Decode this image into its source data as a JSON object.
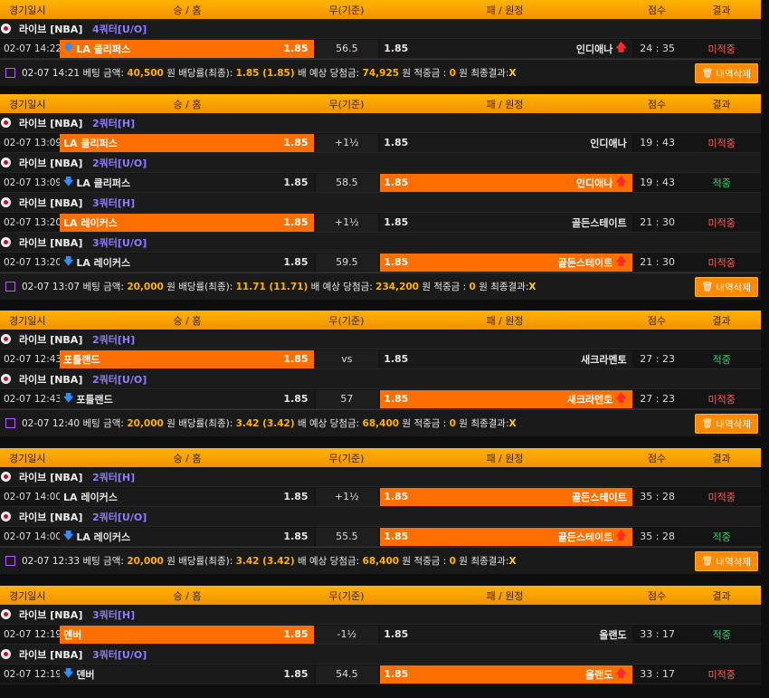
{
  "header": {
    "date": "경기일시",
    "home": "승 / 홈",
    "draw": "무(기준)",
    "away": "패 / 원정",
    "score": "점수",
    "result": "결과"
  },
  "labels": {
    "bet_amount": "베팅 금액:",
    "won": "원",
    "odds": "배당률(최종):",
    "times": "배",
    "expected": "예상 당첨금:",
    "refund": "적중금 :",
    "final": "최종결과:",
    "delete_btn": "내역삭제"
  },
  "icons": {
    "league_ball": "basketball-icon",
    "down": "arrow-down-icon",
    "up": "arrow-up-icon",
    "trash": "trash-icon"
  },
  "colors": {
    "accent": "#ff6f00",
    "header": "#ffb300",
    "fail": "#ff5f5f",
    "win": "#37d46b"
  },
  "bets": [
    {
      "matches": [
        {
          "league": "라이브 [NBA]",
          "period": "4쿼터[U/O]",
          "time": "02-07 14:22",
          "home": "LA 클리퍼스",
          "home_odds": "1.85",
          "draw": "56.5",
          "away": "인디애나",
          "away_odds": "1.85",
          "score": "24 : 35",
          "result": "미적중",
          "sel": "home",
          "arrow": "down"
        }
      ],
      "summary": {
        "time": "02-07 14:21",
        "amount": "40,500",
        "odds": "1.85 (1.85)",
        "expected": "74,925",
        "refund": "0",
        "final": "X"
      }
    },
    {
      "matches": [
        {
          "league": "라이브 [NBA]",
          "period": "2쿼터[H]",
          "time": "02-07 13:09",
          "home": "LA 클리퍼스",
          "home_odds": "1.85",
          "draw": "+1½",
          "away": "인디애나",
          "away_odds": "1.85",
          "score": "19 : 43",
          "result": "미적중",
          "sel": "home",
          "arrow": ""
        },
        {
          "league": "라이브 [NBA]",
          "period": "2쿼터[U/O]",
          "time": "02-07 13:09",
          "home": "LA 클리퍼스",
          "home_odds": "1.85",
          "draw": "58.5",
          "away": "인디애나",
          "away_odds": "1.85",
          "score": "19 : 43",
          "result": "적중",
          "sel": "away",
          "arrow": "down"
        },
        {
          "league": "라이브 [NBA]",
          "period": "3쿼터[H]",
          "time": "02-07 13:20",
          "home": "LA 레이커스",
          "home_odds": "1.85",
          "draw": "+1½",
          "away": "골든스테이트",
          "away_odds": "1.85",
          "score": "21 : 30",
          "result": "미적중",
          "sel": "home",
          "arrow": ""
        },
        {
          "league": "라이브 [NBA]",
          "period": "3쿼터[U/O]",
          "time": "02-07 13:20",
          "home": "LA 레이커스",
          "home_odds": "1.85",
          "draw": "59.5",
          "away": "골든스테이트",
          "away_odds": "1.85",
          "score": "21 : 30",
          "result": "미적중",
          "sel": "away",
          "arrow": "down"
        }
      ],
      "summary": {
        "time": "02-07 13:07",
        "amount": "20,000",
        "odds": "11.71 (11.71)",
        "expected": "234,200",
        "refund": "0",
        "final": "X"
      }
    },
    {
      "matches": [
        {
          "league": "라이브 [NBA]",
          "period": "2쿼터[H]",
          "time": "02-07 12:43",
          "home": "포틀랜드",
          "home_odds": "1.85",
          "draw": "vs",
          "away": "새크라멘토",
          "away_odds": "1.85",
          "score": "27 : 23",
          "result": "적중",
          "sel": "home",
          "arrow": ""
        },
        {
          "league": "라이브 [NBA]",
          "period": "2쿼터[U/O]",
          "time": "02-07 12:43",
          "home": "포틀랜드",
          "home_odds": "1.85",
          "draw": "57",
          "away": "새크라멘토",
          "away_odds": "1.85",
          "score": "27 : 23",
          "result": "미적중",
          "sel": "away",
          "arrow": "down"
        }
      ],
      "summary": {
        "time": "02-07 12:40",
        "amount": "20,000",
        "odds": "3.42 (3.42)",
        "expected": "68,400",
        "refund": "0",
        "final": "X"
      }
    },
    {
      "matches": [
        {
          "league": "라이브 [NBA]",
          "period": "2쿼터[H]",
          "time": "02-07 14:00",
          "home": "LA 레이커스",
          "home_odds": "1.85",
          "draw": "+1½",
          "away": "골든스테이트",
          "away_odds": "1.85",
          "score": "35 : 28",
          "result": "미적중",
          "sel": "away",
          "arrow": ""
        },
        {
          "league": "라이브 [NBA]",
          "period": "2쿼터[U/O]",
          "time": "02-07 14:00",
          "home": "LA 레이커스",
          "home_odds": "1.85",
          "draw": "55.5",
          "away": "골든스테이트",
          "away_odds": "1.85",
          "score": "35 : 28",
          "result": "적중",
          "sel": "away",
          "arrow": "down"
        }
      ],
      "summary": {
        "time": "02-07 12:33",
        "amount": "20,000",
        "odds": "3.42 (3.42)",
        "expected": "68,400",
        "refund": "0",
        "final": "X"
      }
    },
    {
      "matches": [
        {
          "league": "라이브 [NBA]",
          "period": "3쿼터[H]",
          "time": "02-07 12:19",
          "home": "덴버",
          "home_odds": "1.85",
          "draw": "-1½",
          "away": "올랜도",
          "away_odds": "1.85",
          "score": "33 : 17",
          "result": "적중",
          "sel": "home",
          "arrow": ""
        },
        {
          "league": "라이브 [NBA]",
          "period": "3쿼터[U/O]",
          "time": "02-07 12:19",
          "home": "덴버",
          "home_odds": "1.85",
          "draw": "54.5",
          "away": "올랜도",
          "away_odds": "1.85",
          "score": "33 : 17",
          "result": "미적중",
          "sel": "away",
          "arrow": "down"
        }
      ]
    }
  ]
}
